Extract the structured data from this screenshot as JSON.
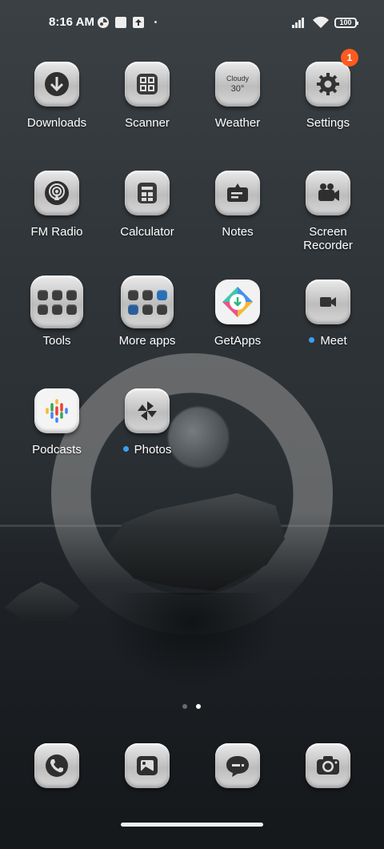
{
  "status_bar": {
    "time": "8:16 AM",
    "battery": "100",
    "icons": [
      "app-notification-icon",
      "square-notification-icon",
      "upload-notification-icon",
      "signal-icon",
      "wifi-icon",
      "battery-icon"
    ]
  },
  "apps": {
    "downloads": {
      "label": "Downloads",
      "icon": "download-arrow-icon"
    },
    "scanner": {
      "label": "Scanner",
      "icon": "scan-frame-icon"
    },
    "weather": {
      "label": "Weather",
      "condition": "Cloudy",
      "temp": "30°",
      "icon": "weather-icon"
    },
    "settings": {
      "label": "Settings",
      "badge": "1",
      "icon": "gear-icon"
    },
    "fm_radio": {
      "label": "FM Radio",
      "icon": "radio-signal-icon"
    },
    "calculator": {
      "label": "Calculator",
      "icon": "calculator-icon"
    },
    "notes": {
      "label": "Notes",
      "icon": "notes-icon"
    },
    "screen_recorder": {
      "label": "Screen Recorder",
      "icon": "video-camera-icon"
    },
    "tools": {
      "label": "Tools",
      "icon": "folder-icon"
    },
    "more_apps": {
      "label": "More apps",
      "icon": "folder-icon"
    },
    "getapps": {
      "label": "GetApps",
      "icon": "getapps-icon"
    },
    "meet": {
      "label": "Meet",
      "icon": "video-call-icon"
    },
    "podcasts": {
      "label": "Podcasts",
      "icon": "podcasts-icon"
    },
    "photos": {
      "label": "Photos",
      "icon": "pinwheel-icon"
    }
  },
  "pages": {
    "count": 2,
    "current": 2
  },
  "dock": [
    {
      "name": "phone",
      "icon": "phone-icon"
    },
    {
      "name": "gallery",
      "icon": "gallery-icon"
    },
    {
      "name": "messages",
      "icon": "chat-bubble-icon"
    },
    {
      "name": "camera",
      "icon": "camera-icon"
    }
  ],
  "colors": {
    "badge": "#ff5a1f",
    "new_app_dot": "#3aa0f0"
  }
}
